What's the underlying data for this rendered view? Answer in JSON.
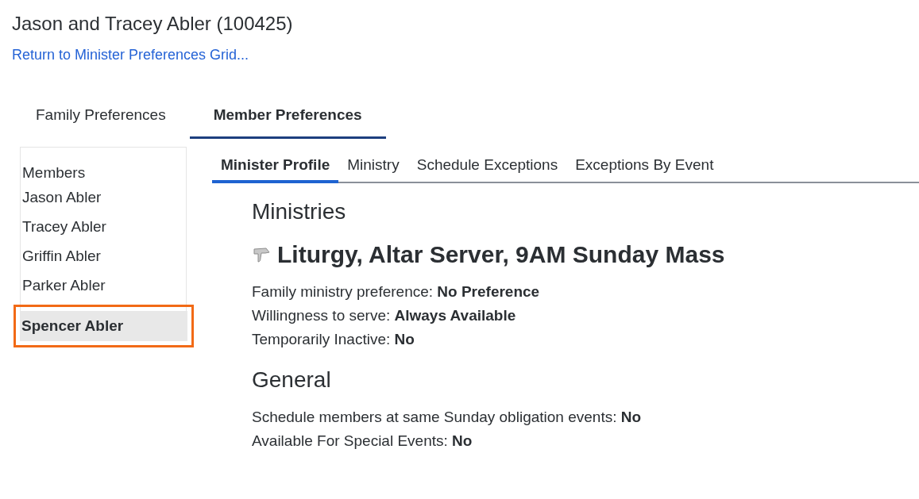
{
  "title": "Jason and Tracey Abler (100425)",
  "return_link": "Return to Minister Preferences Grid...",
  "tabs": [
    {
      "label": "Family Preferences",
      "selected": false
    },
    {
      "label": "Member Preferences",
      "selected": true
    }
  ],
  "members": {
    "heading": "Members",
    "items": [
      {
        "name": "Jason Abler",
        "selected": false
      },
      {
        "name": "Tracey Abler",
        "selected": false
      },
      {
        "name": "Griffin Abler",
        "selected": false
      },
      {
        "name": "Parker Abler",
        "selected": false
      },
      {
        "name": "Spencer Abler",
        "selected": true
      }
    ]
  },
  "subtabs": [
    {
      "label": "Minister Profile",
      "selected": true
    },
    {
      "label": "Ministry",
      "selected": false
    },
    {
      "label": "Schedule Exceptions",
      "selected": false
    },
    {
      "label": "Exceptions By Event",
      "selected": false
    }
  ],
  "sections": [
    {
      "heading": "Ministries",
      "ministry": "Liturgy, Altar Server, 9AM Sunday Mass",
      "lines": [
        "Family ministry preference: **No Preference**",
        "Willingness to serve: **Always Available**",
        "Temporarily Inactive: **No**"
      ]
    },
    {
      "heading": "General",
      "lines": [
        "Schedule members at same Sunday obligation events: **No**",
        "Available For Special Events: **No**"
      ]
    }
  ]
}
